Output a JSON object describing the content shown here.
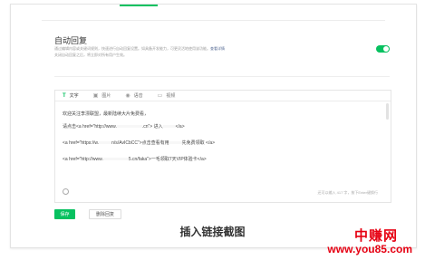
{
  "settings": {
    "title": "自动回复",
    "description_line1": "通过编辑内容或关键词规则，快速进行自动回复设置。如具备开发能力，可更灵活地使用该功能。",
    "description_link": "查看详情",
    "description_line2": "关闭自动回复之后，将立即对所有用户生效。",
    "toggle_on": true
  },
  "editor": {
    "tabs": [
      {
        "icon": "T",
        "label": "文字",
        "active": true
      },
      {
        "icon": "▣",
        "label": "图片",
        "active": false
      },
      {
        "icon": "◉",
        "label": "语音",
        "active": false
      },
      {
        "icon": "▭",
        "label": "视频",
        "active": false
      }
    ],
    "lines": {
      "welcome": "欢迎关注李漂联盟，最新陆续大片免费看，",
      "l2_pre": "请点击<a href=\"http://www.",
      "l2_mid": ".cn\"> 进入",
      "l2_post": "</a>",
      "l3_pre": "<a href=\"https://w.",
      "l3_post": "n/s/AvICbCC\">点击查看有用",
      "l3_end": "先免费领取 </a>",
      "l4_pre": "<a href=\"http://www.",
      "l4_post": "5.cn/faka\">一毛领取7天VIP体验卡</a>"
    },
    "counter": "还可以输入 417 字，按下Enter键换行"
  },
  "buttons": {
    "save": "保存",
    "delete": "删除回复"
  },
  "caption": "插入链接截图",
  "watermark": {
    "cn": "中赚网",
    "url": "www.you85.com"
  },
  "colors": {
    "accent": "#07c160",
    "watermark": "#e60012"
  }
}
